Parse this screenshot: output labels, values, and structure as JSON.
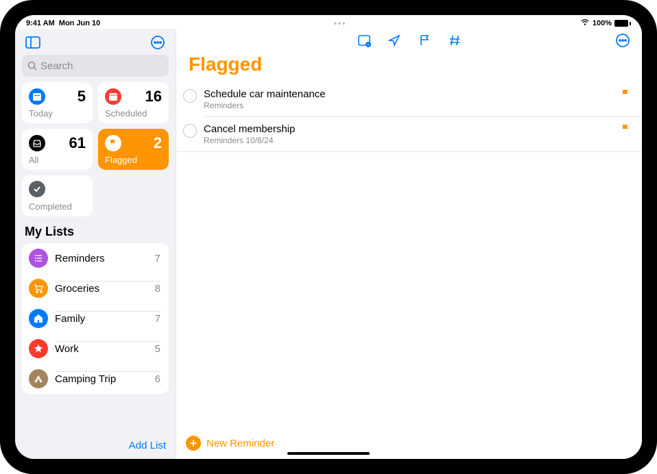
{
  "status": {
    "time": "9:41 AM",
    "date": "Mon Jun 10",
    "battery_pct": "100%"
  },
  "sidebar": {
    "search_placeholder": "Search",
    "section_title": "My Lists",
    "add_list_label": "Add List",
    "smart": {
      "today": {
        "label": "Today",
        "count": "5",
        "icon": "calendar-today-icon",
        "bg": "#007AFF"
      },
      "scheduled": {
        "label": "Scheduled",
        "count": "16",
        "icon": "calendar-icon",
        "bg": "#FF3B30"
      },
      "all": {
        "label": "All",
        "count": "61",
        "icon": "tray-icon",
        "bg": "#000000"
      },
      "flagged": {
        "label": "Flagged",
        "count": "2",
        "icon": "flag-icon",
        "bg": "#FF9500",
        "active": true
      },
      "completed": {
        "label": "Completed",
        "count": "",
        "icon": "checkmark-icon",
        "bg": "#5b6065"
      }
    },
    "lists": [
      {
        "name": "Reminders",
        "count": "7",
        "color": "#AF52DE",
        "icon": "list-bullet-icon"
      },
      {
        "name": "Groceries",
        "count": "8",
        "color": "#FF9500",
        "icon": "cart-icon"
      },
      {
        "name": "Family",
        "count": "7",
        "color": "#007AFF",
        "icon": "house-icon"
      },
      {
        "name": "Work",
        "count": "5",
        "color": "#FF3B30",
        "icon": "star-icon"
      },
      {
        "name": "Camping Trip",
        "count": "6",
        "color": "#A2845E",
        "icon": "tent-icon"
      }
    ]
  },
  "main": {
    "title": "Flagged",
    "accent": "#FF9500",
    "new_reminder_label": "New Reminder",
    "reminders": [
      {
        "title": "Schedule car maintenance",
        "sub": "Reminders",
        "flagged": true
      },
      {
        "title": "Cancel membership",
        "sub": "Reminders  10/8/24",
        "flagged": true
      }
    ]
  }
}
